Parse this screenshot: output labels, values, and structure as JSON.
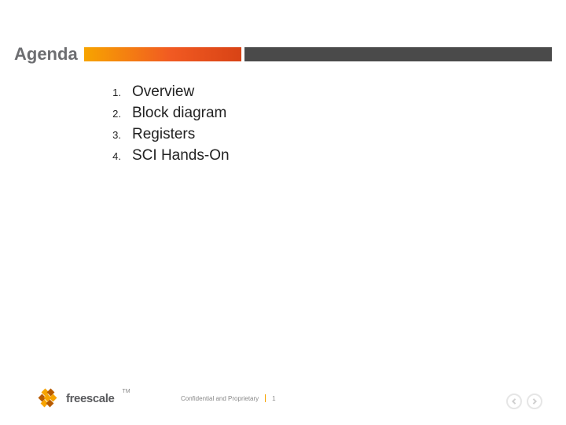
{
  "header": {
    "title": "Agenda"
  },
  "items": [
    {
      "num": "1.",
      "text": "Overview"
    },
    {
      "num": "2.",
      "text": "Block diagram"
    },
    {
      "num": "3.",
      "text": "Registers"
    },
    {
      "num": "4.",
      "text": "SCI Hands-On"
    }
  ],
  "footer": {
    "brand": "freescale",
    "tm": "TM",
    "confidential": "Confidential and Proprietary",
    "page": "1"
  }
}
